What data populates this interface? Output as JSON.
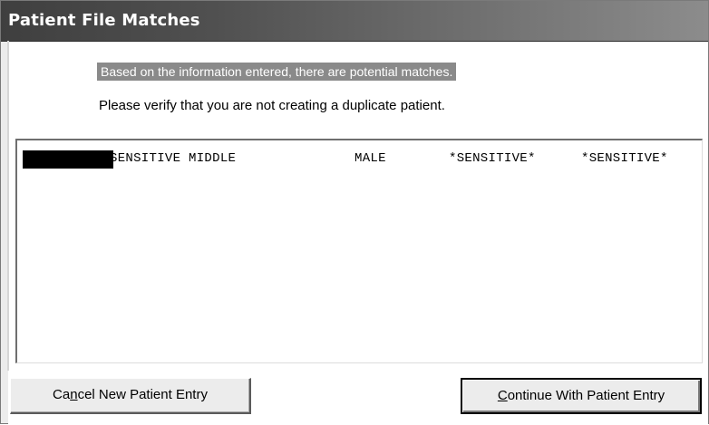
{
  "window": {
    "title": "Patient File Matches"
  },
  "messages": {
    "highlighted": "Based on the information entered, there are potential matches.",
    "instruction": "Please verify that you are not creating a duplicate patient."
  },
  "matches": {
    "rows": [
      {
        "name": "SENSITIVE MIDDLE",
        "sex": "MALE",
        "dob": "*SENSITIVE*",
        "ssn": "*SENSITIVE*"
      }
    ]
  },
  "buttons": {
    "cancel": {
      "pre": "Ca",
      "accel": "n",
      "post": "cel New Patient Entry"
    },
    "continue": {
      "pre": "",
      "accel": "C",
      "post": "ontinue With Patient Entry"
    }
  },
  "colors": {
    "titlebar": "#3f3f3f",
    "highlight": "#8a8a8a",
    "dialog_bg": "#ececec"
  }
}
